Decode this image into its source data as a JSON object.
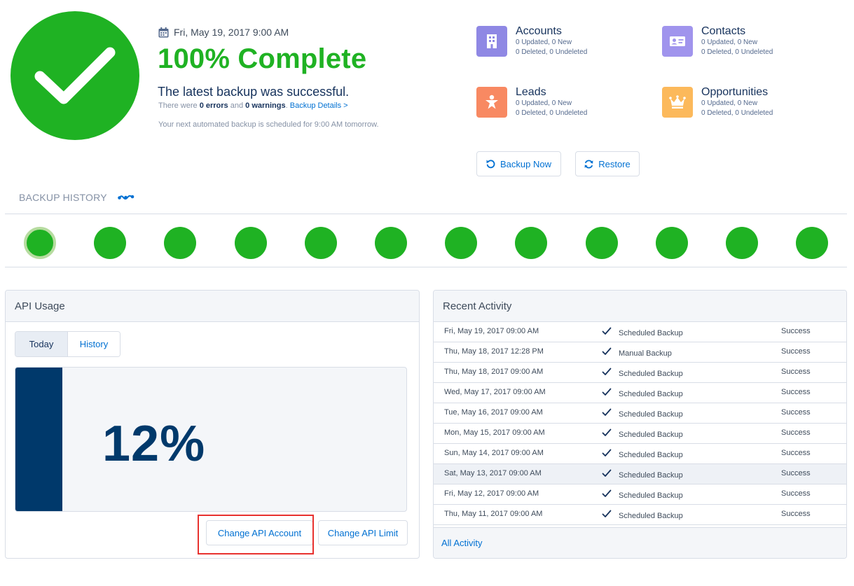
{
  "status": {
    "date": "Fri, May 19, 2017 9:00 AM",
    "title": "100% Complete",
    "subtitle": "The latest backup was successful.",
    "errors_prefix": "There were ",
    "errors_count": "0 errors",
    "errors_mid": " and ",
    "warnings_count": "0 warnings",
    "errors_suffix": ". ",
    "details_link": "Backup Details >",
    "next_backup": "Your next automated backup is scheduled for 9:00 AM tomorrow."
  },
  "objects": [
    {
      "name": "Accounts",
      "line1": "0 Updated, 0 New",
      "line2": "0 Deleted, 0 Undeleted",
      "icon": "building-icon",
      "color": "#7f8de1"
    },
    {
      "name": "Contacts",
      "line1": "0 Updated, 0 New",
      "line2": "0 Deleted, 0 Undeleted",
      "icon": "contact-card-icon",
      "color": "#a094ed"
    },
    {
      "name": "Leads",
      "line1": "0 Updated, 0 New",
      "line2": "0 Deleted, 0 Undeleted",
      "icon": "lead-person-icon",
      "color": "#f88962"
    },
    {
      "name": "Opportunities",
      "line1": "0 Updated, 0 New",
      "line2": "0 Deleted, 0 Undeleted",
      "icon": "crown-icon",
      "color": "#fcb95b"
    }
  ],
  "actions": {
    "backup_now": "Backup Now",
    "restore": "Restore"
  },
  "history": {
    "label": "BACKUP HISTORY",
    "count": 12,
    "selected_index": 0
  },
  "api": {
    "title": "API Usage",
    "tabs": [
      "Today",
      "History"
    ],
    "active_tab": "Today",
    "percent_label": "12%",
    "percent": 0.12,
    "change_account": "Change API Account",
    "change_limit": "Change API Limit"
  },
  "activity": {
    "title": "Recent Activity",
    "rows": [
      {
        "date": "Fri, May 19, 2017 09:00 AM",
        "type": "Scheduled Backup",
        "status": "Success"
      },
      {
        "date": "Thu, May 18, 2017 12:28 PM",
        "type": "Manual Backup",
        "status": "Success"
      },
      {
        "date": "Thu, May 18, 2017 09:00 AM",
        "type": "Scheduled Backup",
        "status": "Success"
      },
      {
        "date": "Wed, May 17, 2017 09:00 AM",
        "type": "Scheduled Backup",
        "status": "Success"
      },
      {
        "date": "Tue, May 16, 2017 09:00 AM",
        "type": "Scheduled Backup",
        "status": "Success"
      },
      {
        "date": "Mon, May 15, 2017 09:00 AM",
        "type": "Scheduled Backup",
        "status": "Success"
      },
      {
        "date": "Sun, May 14, 2017 09:00 AM",
        "type": "Scheduled Backup",
        "status": "Success"
      },
      {
        "date": "Sat, May 13, 2017 09:00 AM",
        "type": "Scheduled Backup",
        "status": "Success"
      },
      {
        "date": "Fri, May 12, 2017 09:00 AM",
        "type": "Scheduled Backup",
        "status": "Success"
      },
      {
        "date": "Thu, May 11, 2017 09:00 AM",
        "type": "Scheduled Backup",
        "status": "Success"
      }
    ],
    "highlighted_index": 7,
    "all_activity": "All Activity"
  }
}
